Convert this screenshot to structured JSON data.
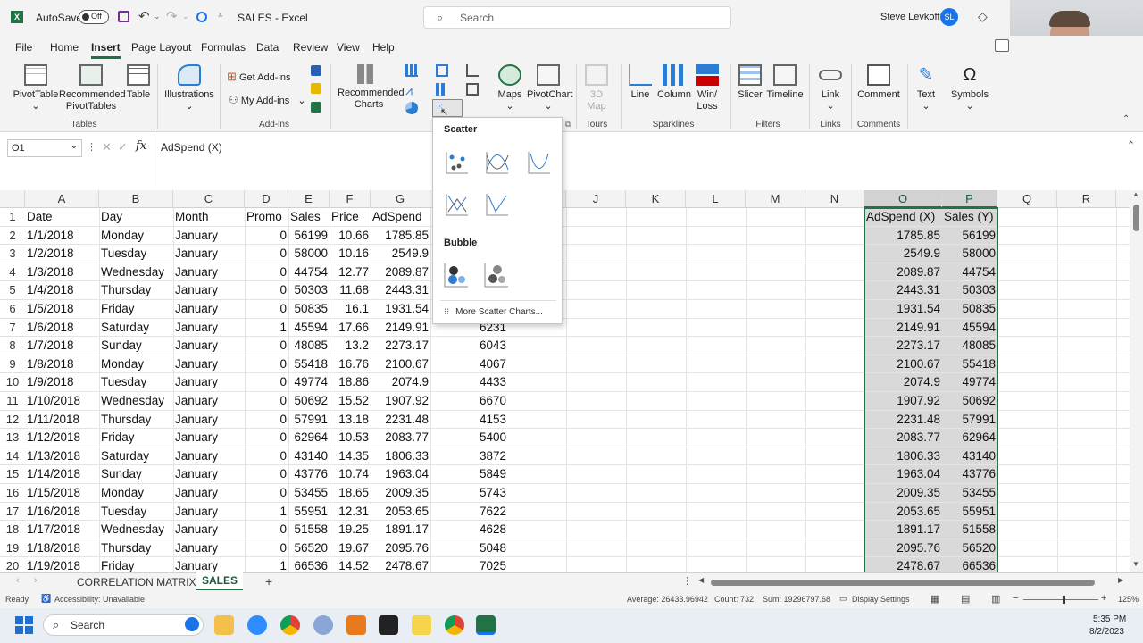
{
  "titlebar": {
    "autosave": "AutoSave",
    "toggle": "Off",
    "filename": "SALES",
    "app": "Excel",
    "search": "Search",
    "user": "Steve Levkoff",
    "initials": "SL"
  },
  "menu": {
    "file": "File",
    "home": "Home",
    "insert": "Insert",
    "page_layout": "Page Layout",
    "formulas": "Formulas",
    "data": "Data",
    "review": "Review",
    "view": "View",
    "help": "Help"
  },
  "ribbon": {
    "pivottable": "PivotTable",
    "recommended_pivot": "Recommended PivotTables",
    "table": "Table",
    "illustrations": "Illustrations",
    "get_addins": "Get Add-ins",
    "my_addins": "My Add-ins",
    "recommended_charts": "Recommended Charts",
    "maps": "Maps",
    "pivotchart": "PivotChart",
    "map3d": "3D Map",
    "line": "Line",
    "column": "Column",
    "winloss": "Win/ Loss",
    "slicer": "Slicer",
    "timeline": "Timeline",
    "link": "Link",
    "comment": "Comment",
    "text": "Text",
    "symbols": "Symbols",
    "grp_tables": "Tables",
    "grp_addins": "Add-ins",
    "grp_tours": "Tours",
    "grp_sparklines": "Sparklines",
    "grp_filters": "Filters",
    "grp_links": "Links",
    "grp_comments": "Comments"
  },
  "dropdown": {
    "scatter": "Scatter",
    "bubble": "Bubble",
    "more": "More Scatter Charts..."
  },
  "formula": {
    "namebox": "O1",
    "fx": "fx",
    "content": "AdSpend (X)"
  },
  "columns": [
    "A",
    "B",
    "C",
    "D",
    "E",
    "F",
    "G",
    "J",
    "K",
    "L",
    "M",
    "N",
    "O",
    "P",
    "Q",
    "R"
  ],
  "headers": {
    "A": "Date",
    "B": "Day",
    "C": "Month",
    "D": "Promo",
    "E": "Sales",
    "F": "Price",
    "G": "AdSpend",
    "O": "AdSpend (X)",
    "P": "Sales (Y)"
  },
  "rows": [
    [
      "1/1/2018",
      "Monday",
      "January",
      "0",
      "56199",
      "10.66",
      "1785.85",
      "",
      "1785.85",
      "56199"
    ],
    [
      "1/2/2018",
      "Tuesday",
      "January",
      "0",
      "58000",
      "10.16",
      "2549.9",
      "",
      "2549.9",
      "58000"
    ],
    [
      "1/3/2018",
      "Wednesday",
      "January",
      "0",
      "44754",
      "12.77",
      "2089.87",
      "",
      "2089.87",
      "44754"
    ],
    [
      "1/4/2018",
      "Thursday",
      "January",
      "0",
      "50303",
      "11.68",
      "2443.31",
      "",
      "2443.31",
      "50303"
    ],
    [
      "1/5/2018",
      "Friday",
      "January",
      "0",
      "50835",
      "16.1",
      "1931.54",
      "",
      "1931.54",
      "50835"
    ],
    [
      "1/6/2018",
      "Saturday",
      "January",
      "1",
      "45594",
      "17.66",
      "2149.91",
      "6231",
      "2149.91",
      "45594"
    ],
    [
      "1/7/2018",
      "Sunday",
      "January",
      "0",
      "48085",
      "13.2",
      "2273.17",
      "6043",
      "2273.17",
      "48085"
    ],
    [
      "1/8/2018",
      "Monday",
      "January",
      "0",
      "55418",
      "16.76",
      "2100.67",
      "4067",
      "2100.67",
      "55418"
    ],
    [
      "1/9/2018",
      "Tuesday",
      "January",
      "0",
      "49774",
      "18.86",
      "2074.9",
      "4433",
      "2074.9",
      "49774"
    ],
    [
      "1/10/2018",
      "Wednesday",
      "January",
      "0",
      "50692",
      "15.52",
      "1907.92",
      "6670",
      "1907.92",
      "50692"
    ],
    [
      "1/11/2018",
      "Thursday",
      "January",
      "0",
      "57991",
      "13.18",
      "2231.48",
      "4153",
      "2231.48",
      "57991"
    ],
    [
      "1/12/2018",
      "Friday",
      "January",
      "0",
      "62964",
      "10.53",
      "2083.77",
      "5400",
      "2083.77",
      "62964"
    ],
    [
      "1/13/2018",
      "Saturday",
      "January",
      "0",
      "43140",
      "14.35",
      "1806.33",
      "3872",
      "1806.33",
      "43140"
    ],
    [
      "1/14/2018",
      "Sunday",
      "January",
      "0",
      "43776",
      "10.74",
      "1963.04",
      "5849",
      "1963.04",
      "43776"
    ],
    [
      "1/15/2018",
      "Monday",
      "January",
      "0",
      "53455",
      "18.65",
      "2009.35",
      "5743",
      "2009.35",
      "53455"
    ],
    [
      "1/16/2018",
      "Tuesday",
      "January",
      "1",
      "55951",
      "12.31",
      "2053.65",
      "7622",
      "2053.65",
      "55951"
    ],
    [
      "1/17/2018",
      "Wednesday",
      "January",
      "0",
      "51558",
      "19.25",
      "1891.17",
      "4628",
      "1891.17",
      "51558"
    ],
    [
      "1/18/2018",
      "Thursday",
      "January",
      "0",
      "56520",
      "19.67",
      "2095.76",
      "5048",
      "2095.76",
      "56520"
    ],
    [
      "1/19/2018",
      "Friday",
      "January",
      "1",
      "66536",
      "14.52",
      "2478.67",
      "7025",
      "2478.67",
      "66536"
    ]
  ],
  "sheets": {
    "tab1": "CORRELATION MATRIX",
    "tab2": "SALES"
  },
  "status": {
    "ready": "Ready",
    "accessibility": "Accessibility: Unavailable",
    "average": "Average: 26433.96942",
    "count": "Count: 732",
    "sum": "Sum: 19296797.68",
    "display": "Display Settings",
    "zoom": "125%"
  },
  "taskbar": {
    "search": "Search",
    "time": "5:35 PM",
    "date": "8/2/2023"
  },
  "colors": {
    "excel_green": "#217346",
    "accent_blue": "#1a73e8"
  }
}
